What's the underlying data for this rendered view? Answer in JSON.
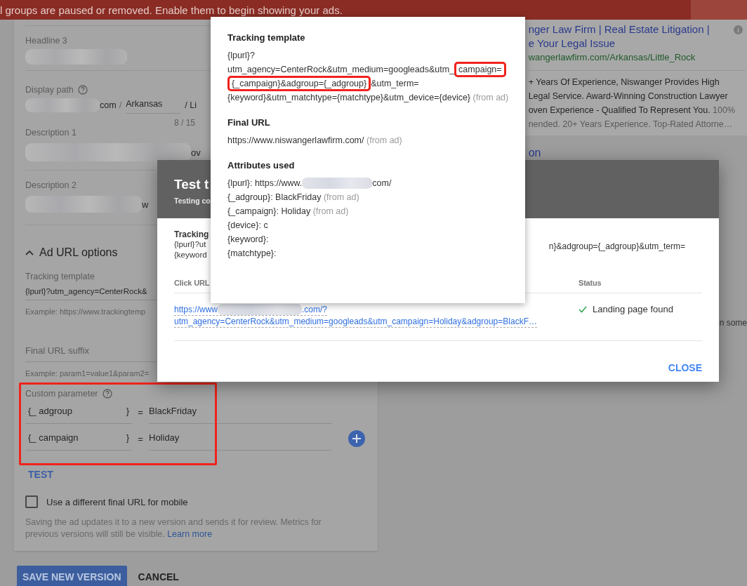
{
  "banner": {
    "message": "l groups are paused or removed. Enable them to begin showing your ads."
  },
  "ad_form": {
    "headline_3": {
      "label": "Headline 3"
    },
    "display_path": {
      "label": "Display path",
      "domain_end": "com",
      "separator": "/",
      "path_1": "Arkansas",
      "path_2_start": "/ Li",
      "counter": "8 / 15"
    },
    "description_1": {
      "label": "Description 1",
      "visible_end": "ov"
    },
    "description_2": {
      "label": "Description 2",
      "visible_end": "w"
    },
    "url_options": {
      "title": "Ad URL options",
      "expanded": true,
      "tracking_template": {
        "label": "Tracking template",
        "value": "{lpurl}?utm_agency=CenterRock&",
        "example": "Example: https://www.trackingtemp"
      },
      "final_url_suffix": {
        "placeholder": "Final URL suffix",
        "example": "Example: param1=value1&param2="
      },
      "custom_parameter": {
        "label": "Custom parameter",
        "highlighted": true,
        "rows": [
          {
            "key_prefix": "{_",
            "key": "adgroup",
            "key_suffix": "}",
            "equals": "=",
            "value": "BlackFriday"
          },
          {
            "key_prefix": "{_",
            "key": "campaign",
            "key_suffix": "}",
            "equals": "=",
            "value": "Holiday"
          }
        ]
      },
      "test_button": "TEST",
      "mobile_url": {
        "label": "Use a different final URL for mobile",
        "checked": false
      },
      "note": {
        "text": "Saving the ad updates it to a new version and sends it for review. Metrics for previous versions will still be visible.",
        "link": "Learn more"
      }
    },
    "buttons": [
      {
        "label": "SAVE NEW VERSION",
        "kind": "primary"
      },
      {
        "label": "CANCEL",
        "kind": "text"
      }
    ]
  },
  "ad_preview": {
    "title_lines": [
      "nger Law Firm | Real Estate Litigation |",
      "e Your Legal Issue"
    ],
    "display_url": "wangerlawfirm.com/Arkansas/Little_Rock",
    "description_lines": [
      {
        "text": "+ Years Of Experience, Niswanger Provides High",
        "faded": false
      },
      {
        "text": "Legal Service. Award-Winning Construction Lawyer",
        "faded": false
      },
      {
        "text": "oven Experience - Qualified To Represent You.",
        "faded_tail": "100%",
        "faded": false
      },
      {
        "text": "nended. 20+ Years Experience. Top-Rated Attorne…",
        "faded": true
      }
    ],
    "link_fragment": "on",
    "side_text": "n some"
  },
  "test_dialog": {
    "title": "Test t",
    "subtitle": "Testing co",
    "tracking_label": "Tracking",
    "tracking_lines": [
      "{lpurl}?ut",
      "{keyword"
    ],
    "tracking_right": "n}&adgroup={_adgroup}&utm_term=",
    "columns": [
      "Click URL",
      "Status"
    ],
    "row": {
      "url_start": "https://www",
      "url_end": ".com/?",
      "url_line_2": "utm_agency=CenterRock&utm_medium=googleads&utm_campaign=Holiday&adgroup=BlackF…",
      "status": "Landing page found",
      "found": true
    },
    "close_button": "CLOSE"
  },
  "details_popup": {
    "tracking_template": {
      "title": "Tracking template",
      "parts": [
        {
          "text": "{lpurl}?",
          "highlighted": false,
          "break_before": false
        },
        {
          "text": "utm_agency=CenterRock&utm_medium=googleads&utm_",
          "highlighted": false,
          "break_before": true
        },
        {
          "text": "campaign=",
          "highlighted": true,
          "break_before": false
        },
        {
          "text": "{_campaign}&adgroup={_adgroup}",
          "highlighted": true,
          "break_before": true
        },
        {
          "text": "&utm_term=",
          "highlighted": false,
          "break_before": false
        },
        {
          "text": "{keyword}&utm_matchtype={matchtype}&utm_device={device}",
          "highlighted": false,
          "break_before": true
        }
      ],
      "note": "(from ad)"
    },
    "final_url": {
      "title": "Final URL",
      "value": "https://www.niswangerlawfirm.com/",
      "note": "(from ad)"
    },
    "attributes": {
      "title": "Attributes used",
      "items": [
        {
          "text": "{lpurl}: https://www.",
          "redacted_after": true,
          "text_after": "com/"
        },
        {
          "text": "{_adgroup}: BlackFriday",
          "note": "(from ad)"
        },
        {
          "text": "{_campaign}: Holiday",
          "note": "(from ad)"
        },
        {
          "text": "{device}: c"
        },
        {
          "text": "{keyword}:"
        },
        {
          "text": "{matchtype}:"
        }
      ]
    }
  }
}
